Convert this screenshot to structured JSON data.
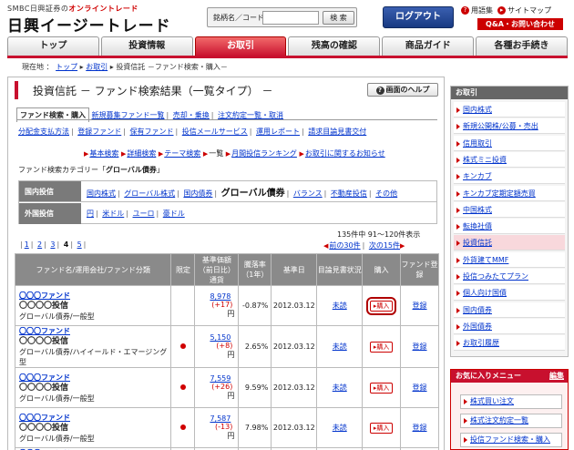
{
  "header": {
    "brand_small_prefix": "SMBC日興証券の",
    "brand_small_accent": "オンライントレード",
    "brand_big": "日興イージートレード",
    "search_label": "銘柄名／コード",
    "search_button": "検 索",
    "logout_button": "ログアウト",
    "glossary_link": "用語集",
    "sitemap_link": "サイトマップ",
    "qa_button": "Q&A・お問い合わせ"
  },
  "tabs": [
    {
      "label": "トップ"
    },
    {
      "label": "投資情報"
    },
    {
      "label": "お取引"
    },
    {
      "label": "残高の確認"
    },
    {
      "label": "商品ガイド"
    },
    {
      "label": "各種お手続き"
    }
  ],
  "breadcrumb": {
    "prefix": "現在地 ：",
    "top": "トップ",
    "trade": "お取引",
    "current": "投資信託 －ファンド検索・購入－"
  },
  "page": {
    "title": "投資信託 － ファンド検索結果（一覧タイプ） －",
    "help_button": "画面のヘルプ"
  },
  "subnav": {
    "current": "ファンド検索・購入",
    "links": [
      "新規募集ファンド一覧",
      "売却・乗換",
      "注文約定一覧・取消"
    ],
    "links2": [
      "分配金支払方法",
      "登録ファンド",
      "保有ファンド",
      "投信メールサービス",
      "運用レポート",
      "請求目論見書交付"
    ],
    "links3": [
      "基本検索",
      "詳細検索",
      "テーマ検索"
    ],
    "links3_current": "一覧",
    "links3_more": [
      "月間投信ランキング",
      "お取引に関するお知らせ"
    ]
  },
  "category": {
    "label": "ファンド検索カテゴリー「",
    "value": "グローバル債券",
    "close": "」"
  },
  "cat_table": {
    "domestic_head": "国内投信",
    "domestic": [
      "国内株式",
      "グローバル株式",
      "国内債券"
    ],
    "domestic_selected": "グローバル債券",
    "domestic_more": [
      "バランス",
      "不動産投信",
      "その他"
    ],
    "foreign_head": "外国投信",
    "foreign": [
      "円",
      "米ドル",
      "ユーロ",
      "豪ドル"
    ]
  },
  "count_info": "135件中 91〜120件表示",
  "pager": {
    "pages": [
      "1",
      "2",
      "3"
    ],
    "current": "4",
    "last": "5",
    "prev": "前の30件",
    "next": "次の15件"
  },
  "table": {
    "headers": [
      "ファンド名/運用会社/ファンド分類",
      "限定",
      "基準価額（前日比）通貨",
      "騰落率（1年）",
      "基準日",
      "目論見書状況",
      "購入",
      "ファンド登録"
    ],
    "rows": [
      {
        "fund": "〇〇〇ファンド",
        "company": "〇〇〇〇投信",
        "category": "グローバル債券/一般型",
        "limited": false,
        "price": "8,978",
        "change": "(+17)",
        "unit": "円",
        "rate": "-0.87%",
        "date": "2012.03.12",
        "prospectus": "未読",
        "buy": "購入",
        "register": "登録"
      },
      {
        "fund": "〇〇〇ファンド",
        "company": "〇〇〇〇投信",
        "category": "グローバル債券/ハイイールド・エマージング型",
        "limited": true,
        "price": "5,150",
        "change": "(+8)",
        "unit": "円",
        "rate": "2.65%",
        "date": "2012.03.12",
        "prospectus": "未読",
        "buy": "購入",
        "register": "登録"
      },
      {
        "fund": "〇〇〇ファンド",
        "company": "〇〇〇〇投信",
        "category": "グローバル債券/一般型",
        "limited": true,
        "price": "7,559",
        "change": "(+26)",
        "unit": "円",
        "rate": "9.59%",
        "date": "2012.03.12",
        "prospectus": "未読",
        "buy": "購入",
        "register": "登録"
      },
      {
        "fund": "〇〇〇ファンド",
        "company": "〇〇〇〇投信",
        "category": "グローバル債券/一般型",
        "limited": true,
        "price": "7,587",
        "change": "(-13)",
        "unit": "円",
        "rate": "7.98%",
        "date": "2012.03.12",
        "prospectus": "未読",
        "buy": "購入",
        "register": "登録"
      },
      {
        "fund": "〇〇〇ファンド",
        "company": "",
        "category": "",
        "limited": false,
        "price": "",
        "change": "",
        "unit": "",
        "rate": "",
        "date": "",
        "prospectus": "",
        "buy": "",
        "register": ""
      }
    ]
  },
  "sidebar": {
    "title": "お取引",
    "items": [
      "国内株式",
      "新規公開株/公募・売出",
      "信用取引",
      "株式ミニ投資",
      "キンカブ",
      "キンカブ定期定額売買",
      "中国株式",
      "転換社債",
      "投資信託",
      "外貨建てMMF",
      "投信つみたてプラン",
      "個人向け国債",
      "国内債券",
      "外国債券",
      "お取引履歴"
    ],
    "active_index": 8
  },
  "favorites": {
    "title": "お気に入りメニュー",
    "edit": "編集",
    "items": [
      "株式買い注文",
      "株式注文約定一覧",
      "投信ファンド検索・購入"
    ]
  },
  "colors": {
    "accent": "#c8102e",
    "link": "#0033cc",
    "logout": "#183a82"
  }
}
